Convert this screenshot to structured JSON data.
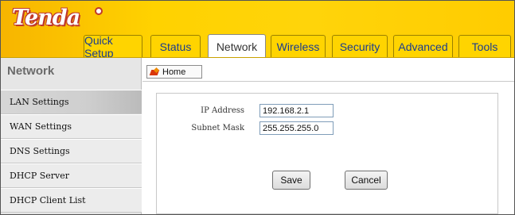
{
  "brand": {
    "logo_text": "Tenda"
  },
  "tabs": [
    {
      "label": "Quick Setup",
      "active": false
    },
    {
      "label": "Status",
      "active": false
    },
    {
      "label": "Network",
      "active": true
    },
    {
      "label": "Wireless",
      "active": false
    },
    {
      "label": "Security",
      "active": false
    },
    {
      "label": "Advanced",
      "active": false
    },
    {
      "label": "Tools",
      "active": false
    }
  ],
  "sidebar": {
    "title": "Network",
    "items": [
      {
        "label": "LAN Settings",
        "active": true
      },
      {
        "label": "WAN Settings",
        "active": false
      },
      {
        "label": "DNS Settings",
        "active": false
      },
      {
        "label": "DHCP Server",
        "active": false
      },
      {
        "label": "DHCP Client List",
        "active": false
      }
    ]
  },
  "main": {
    "home_button": {
      "label": "Home",
      "icon": "home-icon"
    },
    "form": {
      "ip_address": {
        "label": "IP Address",
        "value": "192.168.2.1"
      },
      "subnet_mask": {
        "label": "Subnet Mask",
        "value": "255.255.255.0"
      }
    },
    "buttons": {
      "save": "Save",
      "cancel": "Cancel"
    }
  },
  "colors": {
    "header_accent": "#ffd400",
    "tab_text": "#1a3d8f",
    "logo_red": "#c0392b"
  }
}
